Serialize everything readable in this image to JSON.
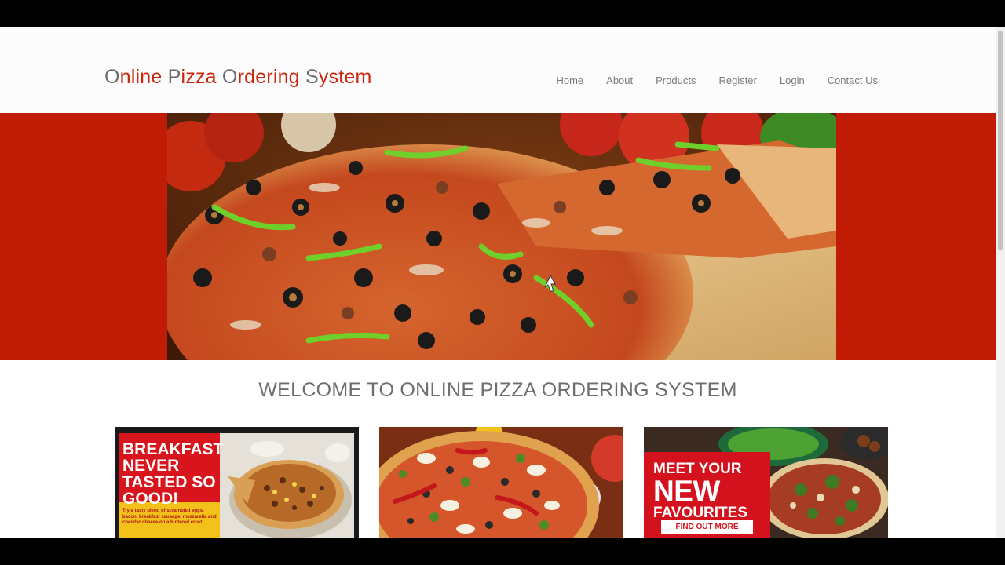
{
  "brand": {
    "title_letters": [
      {
        "cap": "O",
        "rest": "nline "
      },
      {
        "cap": "P",
        "rest": "izza "
      },
      {
        "cap": "O",
        "rest": "rdering "
      },
      {
        "cap": "S",
        "rest": "ystem"
      }
    ]
  },
  "nav": {
    "items": [
      "Home",
      "About",
      "Products",
      "Register",
      "Login",
      "Contact Us"
    ]
  },
  "main": {
    "welcome": "WELCOME TO ONLINE PIZZA ORDERING SYSTEM"
  },
  "cards": {
    "breakfast": {
      "headline": "BREAKFAST NEVER TASTED SO GOOD!",
      "description": "Try a tasty blend of scrambled eggs, bacon, breakfast sausage, mozzarella and cheddar cheese on a buttered crust."
    },
    "favourites": {
      "headline_top": "MEET YOUR",
      "headline_big": "NEW",
      "headline_bottom": "FAVOURITES",
      "button": "FIND OUT MORE"
    }
  },
  "colors": {
    "brand_red": "#c9260b",
    "hero_red": "#c01b04",
    "nav_text": "#7a7a7a"
  },
  "icons": {
    "cursor": "mouse-pointer-icon"
  }
}
